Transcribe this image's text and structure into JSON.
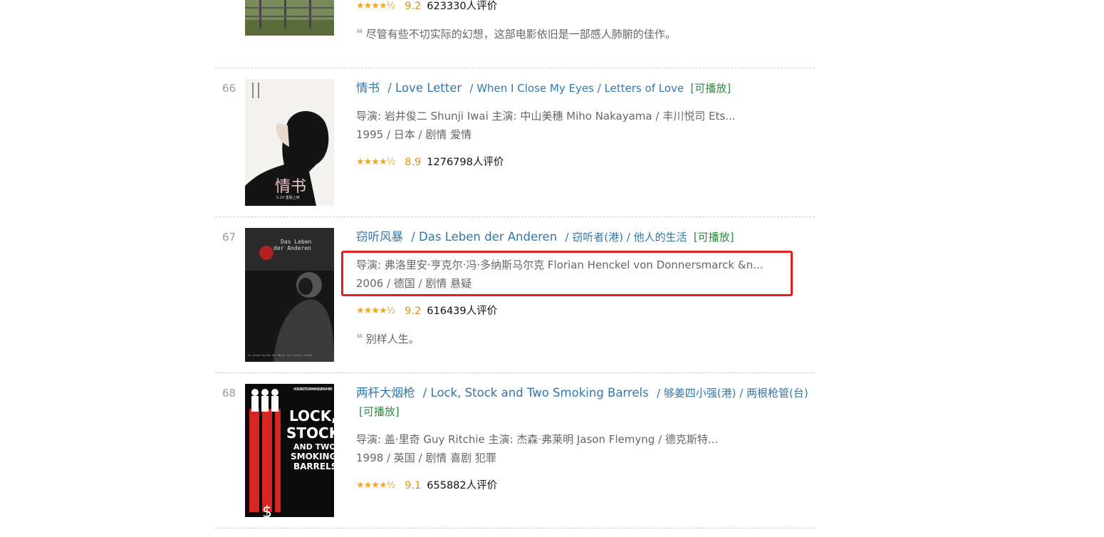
{
  "colors": {
    "link": "#3377aa",
    "playable": "#2b8b3c",
    "score": "#e09015",
    "highlight_box": "#e02020"
  },
  "items": [
    {
      "rating_stars": "★★★★½",
      "rating_score": "9.2",
      "votes": "623330人评价",
      "quote": "尽管有些不切实际的幻想，这部电影依旧是一部感人肺腑的佳作。"
    },
    {
      "rank": "66",
      "title": "情书",
      "title_en": "/ Love Letter",
      "other_titles": "/ When I Close My Eyes / Letters of Love",
      "playable": "[可播放]",
      "crew": "导演: 岩井俊二 Shunji Iwai   主演: 中山美穗 Miho Nakayama / 丰川悦司 Ets...",
      "meta": "1995 / 日本 / 剧情 爱情",
      "rating_stars": "★★★★½",
      "rating_score": "8.9",
      "votes": "1276798人评价"
    },
    {
      "rank": "67",
      "title": "窃听风暴",
      "title_en": "/ Das Leben der Anderen",
      "other_titles": "/ 窃听者(港) / 他人的生活",
      "playable": "[可播放]",
      "crew": "导演: 弗洛里安·亨克尔·冯·多纳斯马尔克 Florian Henckel von Donnersmarck  &n...",
      "meta": "2006 / 德国 / 剧情 悬疑",
      "rating_stars": "★★★★½",
      "rating_score": "9.2",
      "votes": "616439人评价",
      "quote": "别样人生。"
    },
    {
      "rank": "68",
      "title": "两杆大烟枪",
      "title_en": "/ Lock, Stock and Two Smoking Barrels",
      "other_titles": "/ 够姜四小强(港) / 两根枪管(台)",
      "playable": "[可播放]",
      "crew": "导演: 盖·里奇 Guy Ritchie   主演: 杰森·弗莱明 Jason Flemyng / 德克斯特...",
      "meta": "1998 / 英国 / 剧情 喜剧 犯罪",
      "rating_stars": "★★★★½",
      "rating_score": "9.1",
      "votes": "655882人评价"
    }
  ],
  "posters": {
    "p66_text": "情书",
    "p66_date": "5.20 重磅上映",
    "p67_line1": "Das Leben",
    "p67_line2": "der Anderen",
    "p67_tagline": "In einem System der Macht ist nichts privat.",
    "p68_tag": "A DISGRACE TO CRIMINALS EVERYWHERE.",
    "p68_l1": "LOCK,",
    "p68_l2": "STOCK",
    "p68_l3": "AND TWO",
    "p68_l4": "SMOKING",
    "p68_l5": "BARRELS"
  }
}
